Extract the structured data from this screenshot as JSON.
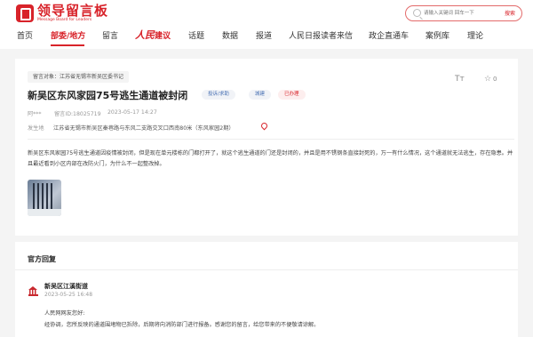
{
  "header": {
    "logo_main": "领导留言板",
    "logo_sub": "Message Board for Leaders",
    "search_placeholder": "请输入关键词 回车一下",
    "search_button": "搜索"
  },
  "nav": {
    "items": [
      "首页",
      "部委/地方",
      "留言",
      "话题",
      "数据",
      "报道",
      "人民日报读者来信",
      "政企直通车",
      "案例库",
      "理论"
    ],
    "brand_main": "人民",
    "brand_sub": "建议"
  },
  "message": {
    "target_tag": "留言对象：江苏省无锡市新吴区委书记",
    "title": "新吴区东风家园75号逃生通道被封闭",
    "badges": [
      "投诉/求助",
      "城建",
      "已办理"
    ],
    "font_icon": "Tт",
    "fav_icon": "☆",
    "fav_count": "0",
    "author": "阿***",
    "message_id": "留言ID:18025719",
    "date": "2023-05-17 14:27",
    "location_label": "发生地",
    "location": "江苏省无锡市新吴区秦巷路与东风二支路交叉口西南80米（东风家园2期）",
    "body": "新吴区东风家园75号逃生通道因疫情被封闭，但是现在单元楼栋的门都打开了，就这个逃生通道的门还是封闭的，并且是用不锈钢条直接封死的，万一有什么情况，这个通道就无法逃生，存在隐患。并且最近看到小区内部在改防火门，为什么不一起整改掉。"
  },
  "reply": {
    "section_title": "官方回复",
    "org": "新吴区江溪街道",
    "time": "2023-05-25 16:48",
    "greeting": "人民网网友您好:",
    "text": "经协调，您所反映的通道围堵物已拆除，后期将向消防部门进行报备。感谢您的留言，给您带来的不便敬请谅解。"
  }
}
